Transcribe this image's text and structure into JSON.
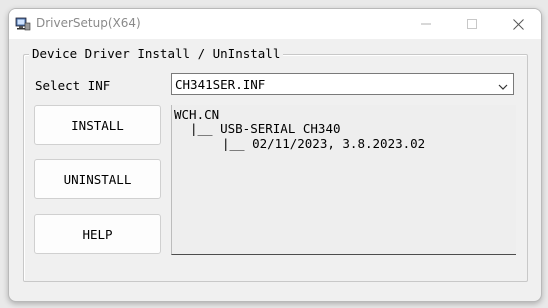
{
  "window": {
    "title": "DriverSetup(X64)",
    "icon": "driver-setup-app-icon",
    "controls": [
      "minimize-icon",
      "maximize-icon",
      "close-icon"
    ]
  },
  "group": {
    "label": "Device Driver Install / UnInstall"
  },
  "inf_select": {
    "label": "Select INF",
    "value": "CH341SER.INF"
  },
  "buttons": {
    "install": "INSTALL",
    "uninstall": "UNINSTALL",
    "help": "HELP"
  },
  "info": {
    "line1": "WCH.CN",
    "line2": "|__ USB-SERIAL CH340",
    "line3": "|__ 02/11/2023, 3.8.2023.02"
  }
}
